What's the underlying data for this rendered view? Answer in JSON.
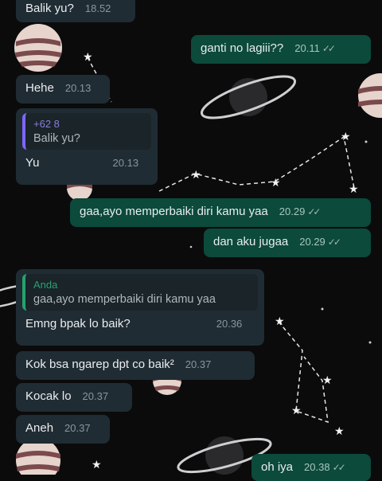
{
  "messages": [
    {
      "text": "Balik yu?",
      "time": "18.52"
    },
    {
      "text": "ganti no lagiii??",
      "time": "20.11",
      "ticks": "✓✓"
    },
    {
      "text": "Hehe",
      "time": "20.13"
    },
    {
      "reply_name": "+62 8",
      "reply_text": "Balik yu?",
      "text": "Yu",
      "time": "20.13"
    },
    {
      "text": "gaa,ayo memperbaiki diri kamu yaa",
      "time": "20.29",
      "ticks": "✓✓"
    },
    {
      "text": "dan aku jugaa",
      "time": "20.29",
      "ticks": "✓✓"
    },
    {
      "reply_name": "Anda",
      "reply_text": "gaa,ayo memperbaiki diri kamu yaa",
      "text": "Emng bpak lo baik?",
      "time": "20.36"
    },
    {
      "text": "Kok bsa ngarep dpt co baik²",
      "time": "20.37"
    },
    {
      "text": "Kocak lo",
      "time": "20.37"
    },
    {
      "text": "Aneh",
      "time": "20.37"
    },
    {
      "text": "oh iya",
      "time": "20.38",
      "ticks": "✓✓"
    }
  ],
  "colors": {
    "background": "#0b0b0c",
    "incoming_bubble": "#202c33",
    "outgoing_bubble": "#0c4a3b",
    "reply_accent_contact": "#7f66ff",
    "reply_accent_self": "#26a36e"
  },
  "wallpaper": [
    "planet-icon",
    "ringed-planet-icon",
    "star-icon",
    "constellation-icon"
  ]
}
